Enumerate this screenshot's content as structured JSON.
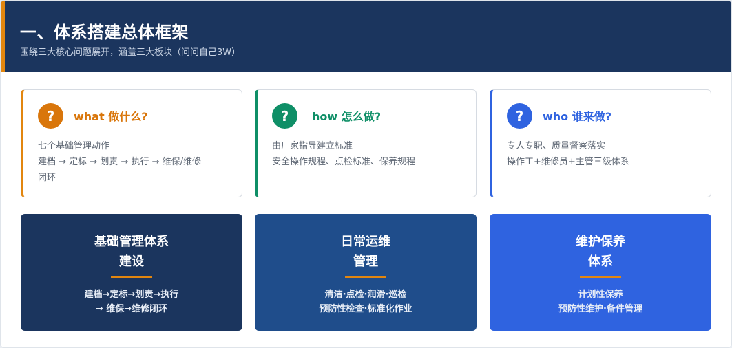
{
  "header": {
    "title": "一、体系搭建总体框架",
    "subtitle": "围绕三大核心问题展开，涵盖三大板块（问问自己3W）"
  },
  "colors": {
    "header_bg": "#1b355e",
    "accent_orange": "#e2860f",
    "what": "#d9760b",
    "how": "#0f8f67",
    "who": "#2f63e0",
    "block1": "#1b355e",
    "block2": "#1f4d8b",
    "block3": "#2f63e0"
  },
  "cards": [
    {
      "icon": "question-icon",
      "badge": "?",
      "title": "what 做什么?",
      "lines": [
        "七个基础管理动作",
        "建档 → 定标 → 划责 → 执行 → 维保/维修",
        "闭环"
      ]
    },
    {
      "icon": "question-icon",
      "badge": "?",
      "title": "how 怎么做?",
      "lines": [
        "由厂家指导建立标准",
        "安全操作规程、点检标准、保养规程"
      ]
    },
    {
      "icon": "question-icon",
      "badge": "?",
      "title": "who 谁来做?",
      "lines": [
        "专人专职、质量督察落实",
        "操作工+维修员+主管三级体系"
      ]
    }
  ],
  "blocks": [
    {
      "title_lines": [
        "基础管理体系",
        "建设"
      ],
      "desc_lines": [
        "建档→定标→划责→执行",
        "→ 维保→维修闭环"
      ]
    },
    {
      "title_lines": [
        "日常运维",
        "管理"
      ],
      "desc_lines": [
        "清洁·点检·润滑·巡检",
        "预防性检查·标准化作业"
      ]
    },
    {
      "title_lines": [
        "维护保养",
        "体系"
      ],
      "desc_lines": [
        "计划性保养",
        "预防性维护·备件管理"
      ]
    }
  ]
}
